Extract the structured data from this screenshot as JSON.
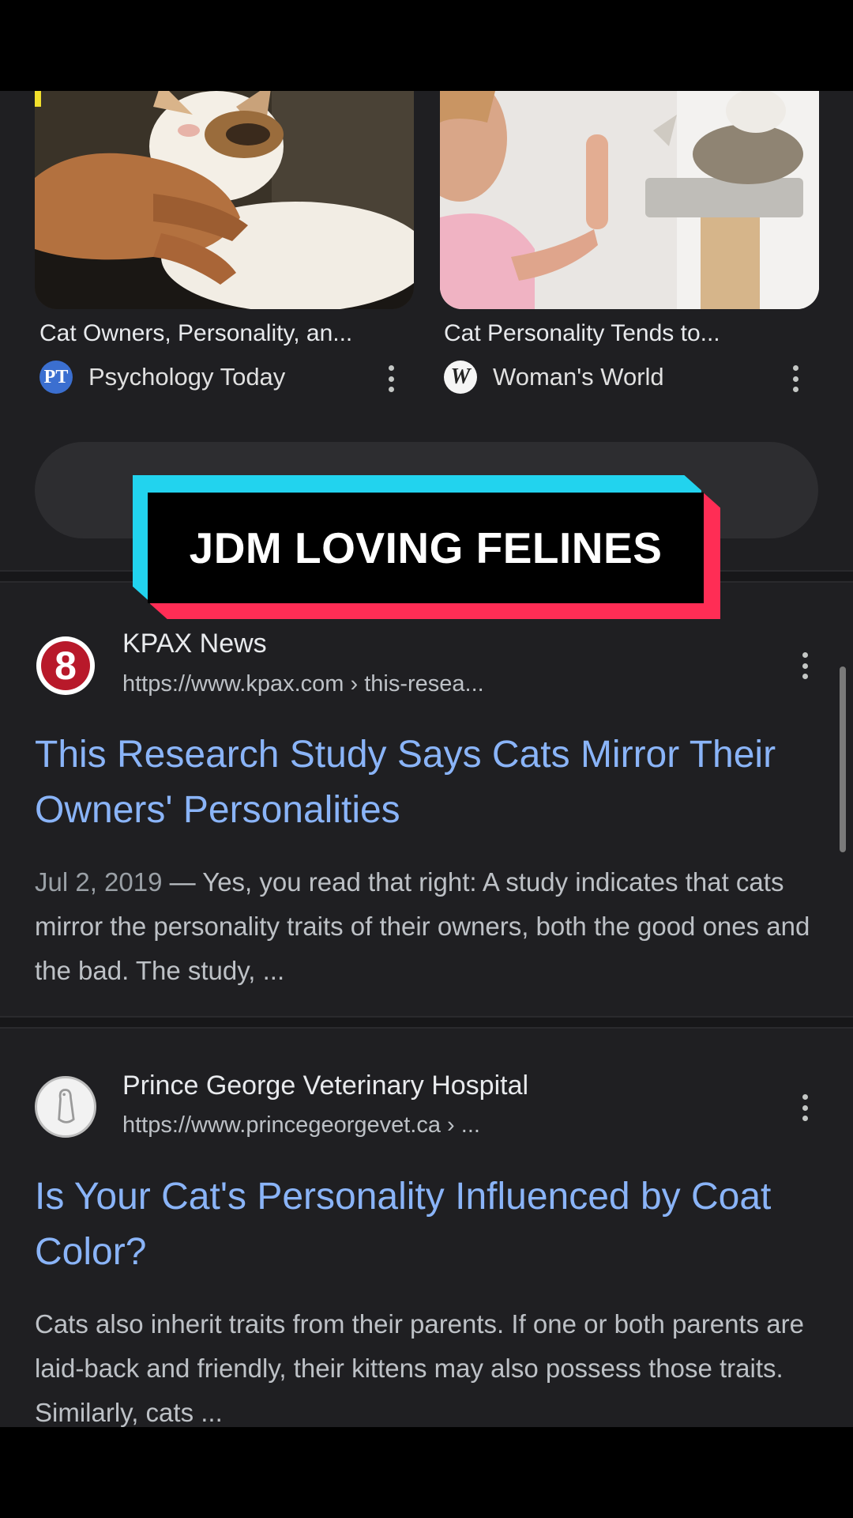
{
  "image_results": [
    {
      "title": "Cat Owners, Personality, an...",
      "source": "Psychology Today",
      "icon_text": "PT",
      "icon": "psychology-today-logo"
    },
    {
      "title": "Cat Personality Tends to...",
      "source": "Woman's World",
      "icon_text": "W",
      "icon": "womans-world-logo"
    }
  ],
  "overlay": {
    "text": "JDM LOVING FELINES",
    "colors": {
      "cyan": "#22d3ee",
      "pink": "#ff2d55"
    }
  },
  "results": [
    {
      "site_name": "KPAX News",
      "url": "https://www.kpax.com › this-resea...",
      "logo_text": "8",
      "title": "This Research Study Says Cats Mirror Their Owners' Personalities",
      "date": "Jul 2, 2019",
      "snippet": " — Yes, you read that right: A study indicates that cats mirror the personality traits of their owners, both the good ones and the bad. The study, ..."
    },
    {
      "site_name": "Prince George Veterinary Hospital",
      "url": "https://www.princegeorgevet.ca › ...",
      "title": "Is Your Cat's Personality Influenced by Coat Color?",
      "snippet": "Cats also inherit traits from their parents. If one or both parents are laid-back and friendly, their kittens may also possess those traits. Similarly, cats ..."
    }
  ],
  "colors": {
    "background": "#1f1f22",
    "link": "#8ab4f8",
    "text": "#e8eaed",
    "muted": "#bdc1c6"
  }
}
